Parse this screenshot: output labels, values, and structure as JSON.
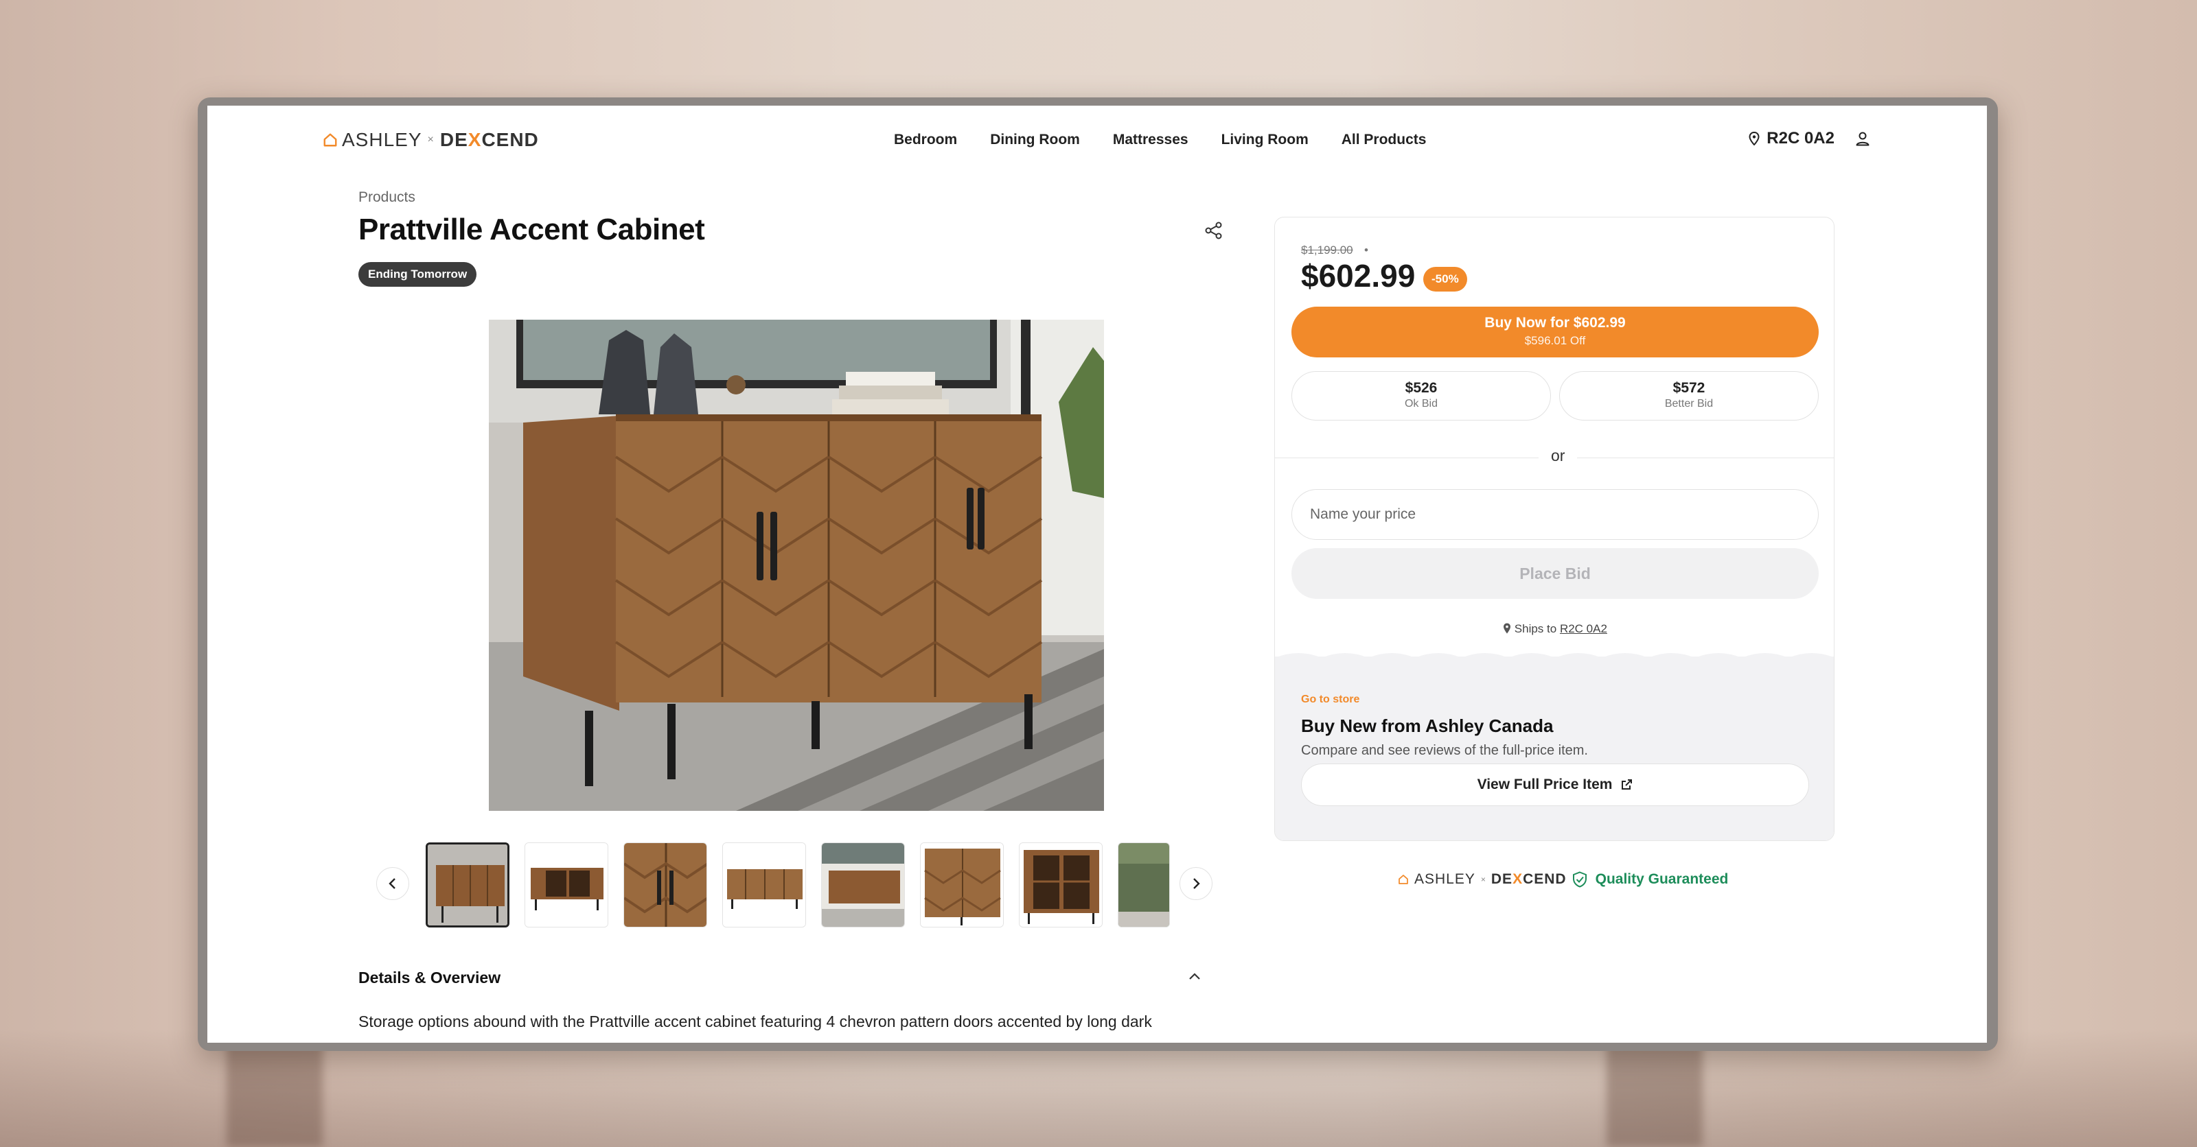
{
  "brand": {
    "part1": "ASHLEY",
    "sep": "×",
    "part2a": "DE",
    "part2x": "X",
    "part2b": "CEND",
    "accent": "#f28a2a"
  },
  "nav": {
    "items": [
      "Bedroom",
      "Dining Room",
      "Mattresses",
      "Living Room",
      "All Products"
    ]
  },
  "header": {
    "postal": "R2C 0A2"
  },
  "product": {
    "breadcrumb": "Products",
    "title": "Prattville Accent Cabinet",
    "badge": "Ending Tomorrow",
    "thumbnail_count": 8,
    "selected_thumbnail": 1
  },
  "details": {
    "heading": "Details & Overview",
    "text": "Storage options abound with the Prattville accent cabinet featuring 4 chevron pattern doors accented by long dark"
  },
  "pricing": {
    "was": "$1,199.00",
    "dot": "•",
    "price": "$602.99",
    "discount": "-50%",
    "buy_now": "Buy Now for $602.99",
    "buy_sub": "$596.01 Off",
    "bids": [
      {
        "value": "$526",
        "label": "Ok Bid"
      },
      {
        "value": "$572",
        "label": "Better Bid"
      }
    ],
    "or": "or",
    "input_placeholder": "Name your price",
    "place_bid": "Place Bid",
    "ships_to": "Ships to",
    "ships_postal": "R2C 0A2"
  },
  "store": {
    "goto": "Go to store",
    "title": "Buy New from Ashley Canada",
    "subtitle": "Compare and see reviews of the full-price item.",
    "button": "View Full Price Item"
  },
  "guarantee": {
    "label": "Quality Guaranteed",
    "color": "#1d8d5a"
  }
}
